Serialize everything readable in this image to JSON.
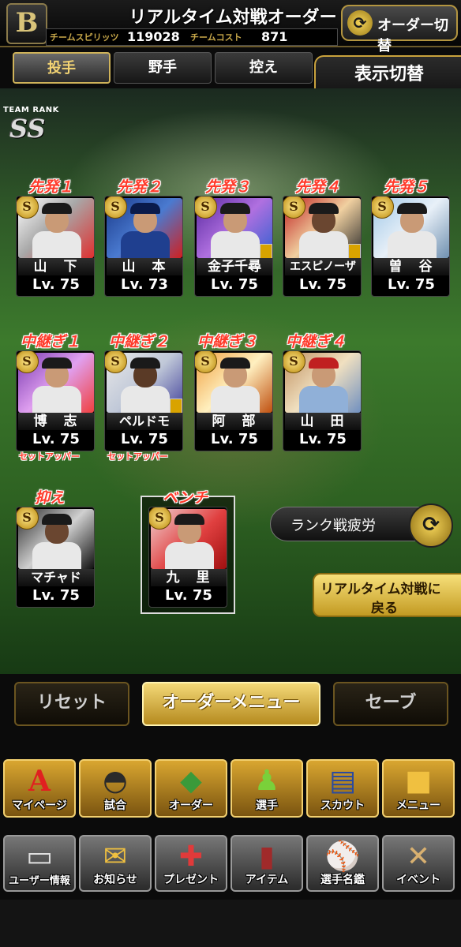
{
  "header": {
    "logo_text": "B",
    "title": "リアルタイム対戦オーダー",
    "team_spirit_label": "チームスピリッツ",
    "team_spirit_value": "119028",
    "team_cost_label": "チームコスト",
    "team_cost_value": "871",
    "order_switch_label": "オーダー切替",
    "order_switch_icon": "swap-arrows-icon"
  },
  "tabs": [
    {
      "label": "投手",
      "active": true
    },
    {
      "label": "野手",
      "active": false
    },
    {
      "label": "控え",
      "active": false
    }
  ],
  "display_toggle": {
    "label": "表示切替",
    "value": "ー"
  },
  "team_rank": {
    "label": "TEAM RANK",
    "value": "SS"
  },
  "starters": [
    {
      "slot": "先発１",
      "name": "山　下",
      "lv": "Lv. 75",
      "rank": "S"
    },
    {
      "slot": "先発２",
      "name": "山　本",
      "lv": "Lv. 73",
      "rank": "S"
    },
    {
      "slot": "先発３",
      "name": "金子千尋",
      "lv": "Lv. 75",
      "rank": "S"
    },
    {
      "slot": "先発４",
      "name": "エスピノーザ",
      "lv": "Lv. 75",
      "rank": "S"
    },
    {
      "slot": "先発５",
      "name": "曽　谷",
      "lv": "Lv. 75",
      "rank": "S"
    }
  ],
  "relievers": [
    {
      "slot": "中継ぎ１",
      "name": "博　志",
      "lv": "Lv. 75",
      "rank": "S",
      "role": "セットアッパー"
    },
    {
      "slot": "中継ぎ２",
      "name": "ペルドモ",
      "lv": "Lv. 75",
      "rank": "S",
      "role": "セットアッパー"
    },
    {
      "slot": "中継ぎ３",
      "name": "阿　部",
      "lv": "Lv. 75",
      "rank": "S",
      "role": ""
    },
    {
      "slot": "中継ぎ４",
      "name": "山　田",
      "lv": "Lv. 75",
      "rank": "S",
      "role": ""
    }
  ],
  "closer": {
    "slot": "抑え",
    "name": "マチャド",
    "lv": "Lv. 75",
    "rank": "S"
  },
  "bench": {
    "slot": "ベンチ",
    "name": "九　里",
    "lv": "Lv. 75",
    "rank": "S"
  },
  "rank_fatigue": {
    "label": "ランク戦疲労",
    "icon": "swap-arrows-icon"
  },
  "back_button": {
    "line1": "リアルタイム対戦に",
    "line2": "戻る"
  },
  "actions": {
    "reset": "リセット",
    "order_menu": "オーダーメニュー",
    "save": "セーブ"
  },
  "nav_primary": [
    {
      "label": "マイページ",
      "icon": "letter-a-icon"
    },
    {
      "label": "試合",
      "icon": "stadium-icon"
    },
    {
      "label": "オーダー",
      "icon": "field-diamond-icon"
    },
    {
      "label": "選手",
      "icon": "player-icon"
    },
    {
      "label": "スカウト",
      "icon": "scout-card-icon"
    },
    {
      "label": "メニュー",
      "icon": "mascot-icon"
    }
  ],
  "nav_secondary": [
    {
      "label": "ユーザー情報",
      "icon": "id-card-icon"
    },
    {
      "label": "お知らせ",
      "icon": "speech-bubble-icon"
    },
    {
      "label": "プレゼント",
      "icon": "gift-box-icon"
    },
    {
      "label": "アイテム",
      "icon": "book-icon"
    },
    {
      "label": "選手名鑑",
      "icon": "pitcher-photo-icon"
    },
    {
      "label": "イベント",
      "icon": "crossed-bats-icon"
    }
  ],
  "colors": {
    "gold": "#c9a23d",
    "slot_red": "#ff3a2a",
    "field_green": "#3c7a2c"
  }
}
